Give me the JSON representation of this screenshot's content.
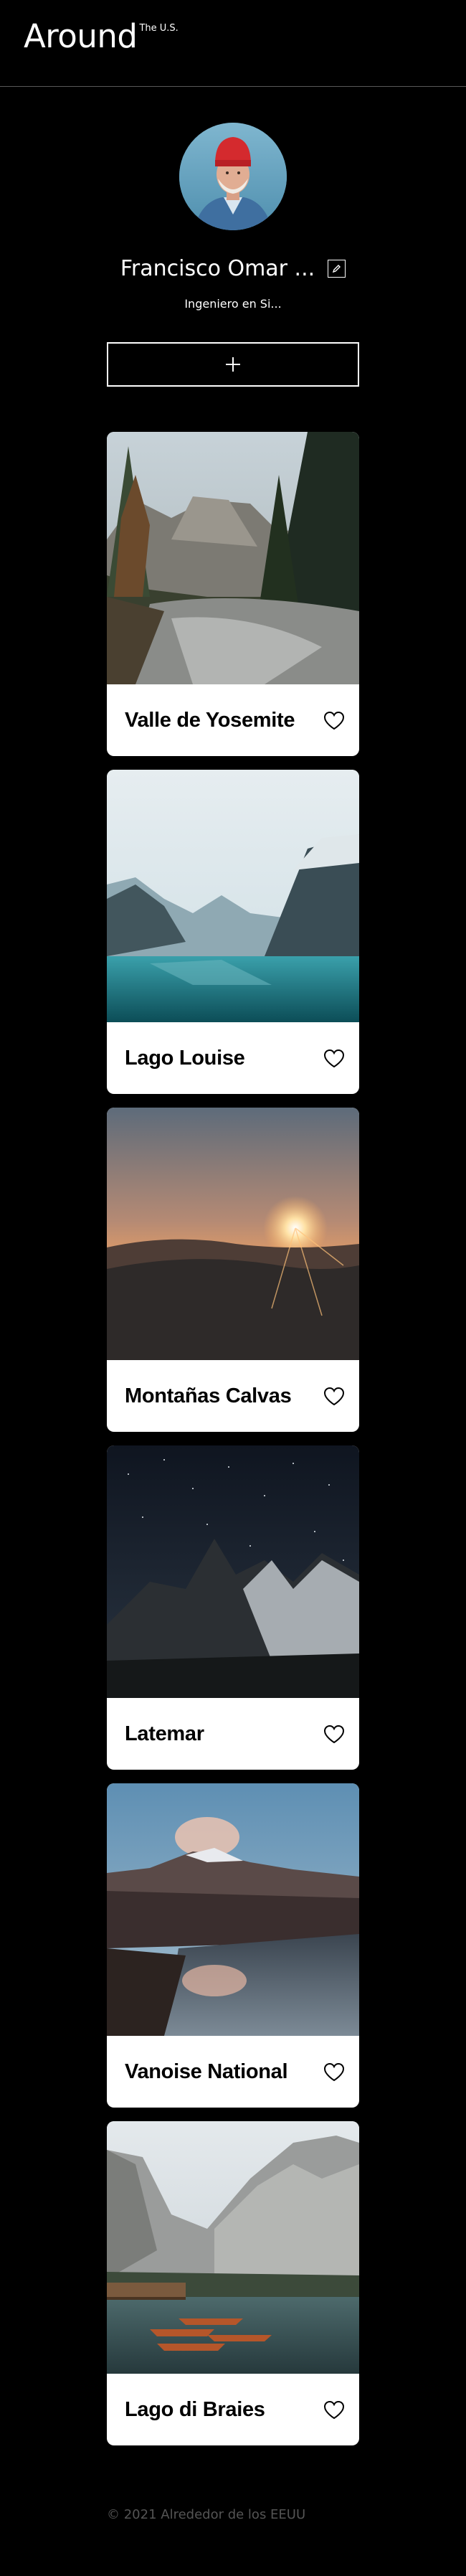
{
  "header": {
    "logo_main": "Around",
    "logo_sup": "The U.S."
  },
  "profile": {
    "name": "Francisco Omar ...",
    "job": "Ingeniero en Si...",
    "avatar_icon": "profile-photo"
  },
  "add_button": {
    "icon": "plus-icon"
  },
  "cards": [
    {
      "title": "Valle de Yosemite"
    },
    {
      "title": "Lago Louise"
    },
    {
      "title": "Montañas Calvas"
    },
    {
      "title": "Latemar"
    },
    {
      "title": "Vanoise National"
    },
    {
      "title": "Lago di Braies"
    }
  ],
  "footer": {
    "text": "© 2021 Alrededor de los EEUU"
  },
  "colors": {
    "background": "#000000",
    "card": "#ffffff",
    "footer_text": "#545454"
  }
}
